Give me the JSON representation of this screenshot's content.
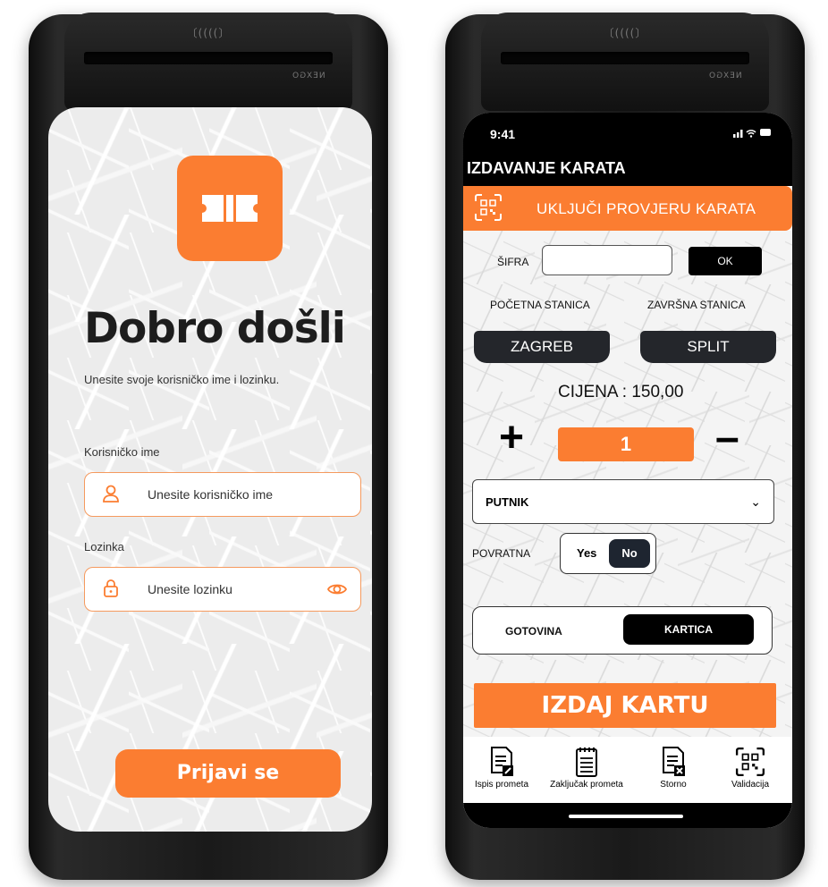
{
  "left_screen": {
    "welcome_title": "Dobro došli",
    "subtitle": "Unesite svoje korisničko ime i lozinku.",
    "username_label": "Korisničko ime",
    "username_placeholder": "Unesite korisničko ime",
    "password_label": "Lozinka",
    "password_placeholder": "Unesite lozinku",
    "login_button": "Prijavi se"
  },
  "right_screen": {
    "status_time": "9:41",
    "app_title": "IZDAVANJE KARATA",
    "banner_label": "UKLJUČI PROVJERU KARATA",
    "code_label": "ŠIFRA",
    "code_value": "",
    "ok_button": "OK",
    "start_station_label": "POČETNA STANICA",
    "end_station_label": "ZAVRŠNA STANICA",
    "start_station": "ZAGREB",
    "end_station": "SPLIT",
    "price": "CIJENA : 150,00",
    "quantity": "1",
    "plus": "+",
    "minus": "–",
    "passenger_type": "PUTNIK",
    "return_label": "POVRATNA",
    "return_yes": "Yes",
    "return_no": "No",
    "pay_cash": "GOTOVINA",
    "pay_card": "KARTICA",
    "issue_button": "IZDAJ KARTU",
    "nav": [
      {
        "label": "Ispis prometa",
        "icon": "receipt-edit-icon"
      },
      {
        "label": "Zaključak prometa",
        "icon": "notepad-icon"
      },
      {
        "label": "Storno",
        "icon": "receipt-cancel-icon"
      },
      {
        "label": "Validacija",
        "icon": "qr-scan-icon"
      }
    ]
  },
  "colors": {
    "accent": "#fb7d31",
    "dark": "#000000",
    "station_button": "#24262b"
  }
}
